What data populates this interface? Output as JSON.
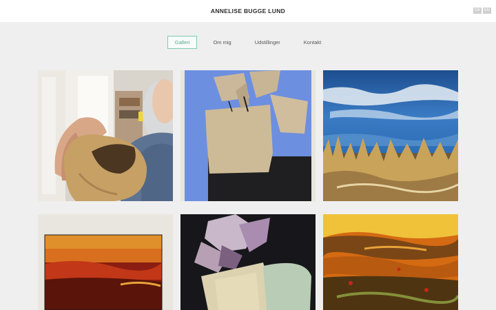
{
  "header": {
    "title": "ANNELISE BUGGE LUND",
    "languages": [
      "DA",
      "EN"
    ]
  },
  "nav": {
    "items": [
      "Galleri",
      "Om mig",
      "Udstillinger",
      "Kontakt"
    ],
    "active": "Galleri"
  },
  "gallery": {
    "artworks": [
      "artist-with-broken-bowl-photo",
      "blue-collage-vase-painting",
      "blue-sea-landscape-painting",
      "red-sunset-painting",
      "dark-collage-flower-vase-painting",
      "orange-abstract-landscape-painting"
    ]
  },
  "colors": {
    "accent": "#7fc9b4",
    "background": "#efefef",
    "header_bg": "#ffffff"
  }
}
